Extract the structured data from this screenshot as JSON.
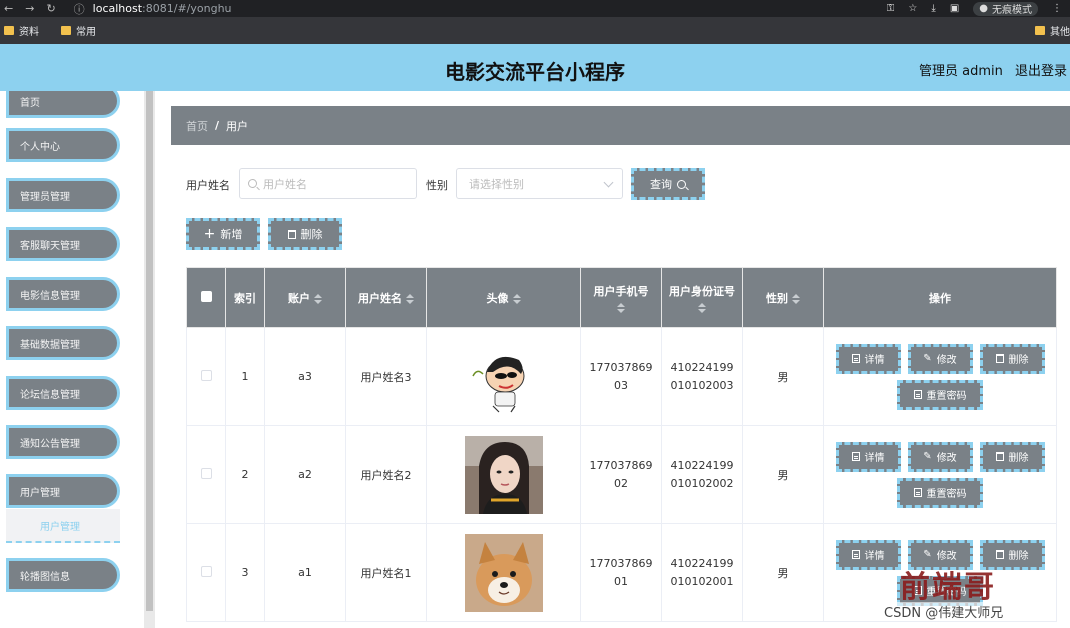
{
  "browser": {
    "url_host": "localhost",
    "url_path": ":8081/#/yonghu",
    "incognito": "无痕模式",
    "bookmarks": [
      "资料",
      "常用"
    ],
    "bookmark_right": "其他"
  },
  "header": {
    "title": "电影交流平台小程序",
    "user": "管理员 admin",
    "logout": "退出登录"
  },
  "sidebar": {
    "items": [
      "首页",
      "个人中心",
      "管理员管理",
      "客服聊天管理",
      "电影信息管理",
      "基础数据管理",
      "论坛信息管理",
      "通知公告管理",
      "用户管理",
      "轮播图信息"
    ],
    "sub_item": "用户管理"
  },
  "breadcrumb": {
    "home": "首页",
    "sep": "/",
    "current": "用户"
  },
  "search": {
    "name_label": "用户姓名",
    "name_placeholder": "用户姓名",
    "gender_label": "性别",
    "gender_placeholder": "请选择性别",
    "query_button": "查询"
  },
  "actions": {
    "add": "新增",
    "delete": "删除"
  },
  "table": {
    "headers": {
      "index": "索引",
      "account": "账户",
      "name": "用户姓名",
      "avatar": "头像",
      "phone": "用户手机号",
      "idcard": "用户身份证号",
      "gender": "性别",
      "ops": "操作"
    },
    "rows": [
      {
        "index": "1",
        "account": "a3",
        "name": "用户姓名3",
        "phone": "17703786903",
        "idcard": "410224199010102003",
        "gender": "男"
      },
      {
        "index": "2",
        "account": "a2",
        "name": "用户姓名2",
        "phone": "17703786902",
        "idcard": "410224199010102002",
        "gender": "男"
      },
      {
        "index": "3",
        "account": "a1",
        "name": "用户姓名1",
        "phone": "17703786901",
        "idcard": "410224199010102001",
        "gender": "男"
      }
    ],
    "ops": {
      "detail": "详情",
      "edit": "修改",
      "delete": "删除",
      "reset": "重置密码"
    }
  },
  "watermark": {
    "logo": "前端哥",
    "credit": "CSDN @伟建大师兄"
  },
  "colors": {
    "accent": "#8dd1ef",
    "gray": "#7a8187"
  }
}
